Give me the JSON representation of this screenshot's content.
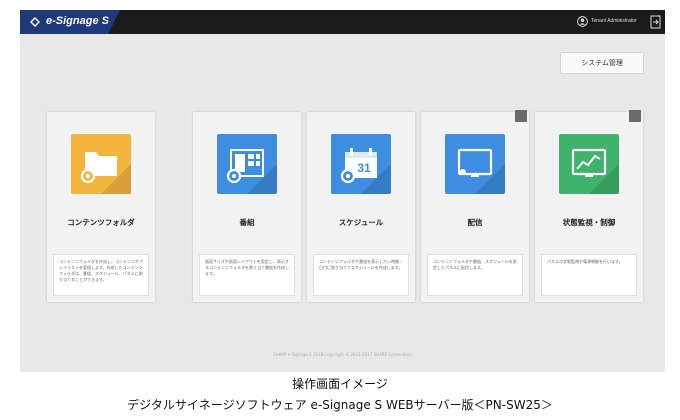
{
  "app": {
    "name": "e-Signage S",
    "user": "Tenant Administrator"
  },
  "header": {
    "system_button": "システム管理"
  },
  "cards": [
    {
      "title": "コンテンツフォルダ",
      "icon": "folder-gear-icon",
      "color": "#f4b53f",
      "description": "コンテンツフォルダを作成し、コンテンツやプレイリストを管理します。作成したコンテンツフォルダは、番組、スケジュール、パネルに割り当てることができます。"
    },
    {
      "title": "番組",
      "icon": "layout-gear-icon",
      "color": "#3d8ee0",
      "description": "画面サイズや画面レイアウトを設定し、表示するコンテンツフォルダを割り当て番組を作成します。"
    },
    {
      "title": "スケジュール",
      "icon": "calendar-gear-icon",
      "color": "#3d8ee0",
      "description": "コンテンツフォルダや番組を表示したい時間・日付に割り当ててスケジュールを作成します。"
    },
    {
      "title": "配信",
      "icon": "monitor-icon",
      "color": "#3d8ee0",
      "description": "コンテンツフォルダや番組、スケジュールを設定したパネルに配信します。"
    },
    {
      "title": "状態監視・制御",
      "icon": "chart-monitor-icon",
      "color": "#3fb36b",
      "description": "パネルの状態監視や電源制御を行います。"
    }
  ],
  "footer": {
    "copyright": "SHARP e-Signage S 2018 Copyright © 2011-2017 SHARP Corporation"
  },
  "caption": {
    "line1": "操作画面イメージ",
    "line2": "デジタルサイネージソフトウェア e-Signage S WEBサーバー版＜PN-SW25＞"
  }
}
